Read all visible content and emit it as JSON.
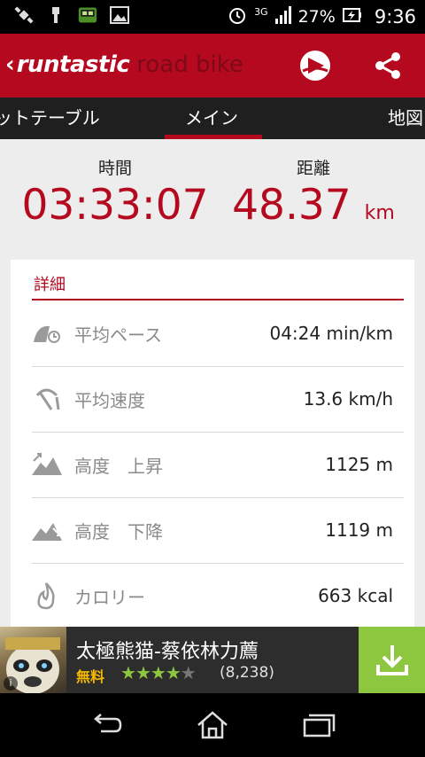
{
  "status_bar": {
    "network": "3G",
    "battery": "27%",
    "time": "9:36"
  },
  "app_bar": {
    "brand": "runtastic",
    "subtitle": "road bike"
  },
  "tabs": [
    {
      "label": "ットテーブル"
    },
    {
      "label": "メイン",
      "selected": true
    },
    {
      "label": "地図"
    }
  ],
  "summary": {
    "time_label": "時間",
    "time_value": "03:33:07",
    "distance_label": "距離",
    "distance_value": "48.37",
    "distance_unit": "km"
  },
  "details": {
    "title": "詳細",
    "rows": [
      {
        "icon": "pace-icon",
        "label": "平均ペース",
        "value": "04:24 min/km"
      },
      {
        "icon": "speedometer-icon",
        "label": "平均速度",
        "value": "13.6  km/h"
      },
      {
        "icon": "elevation-gain-icon",
        "label": "高度　上昇",
        "value": "1125 m"
      },
      {
        "icon": "elevation-loss-icon",
        "label": "高度　下降",
        "value": "1119 m"
      },
      {
        "icon": "flame-icon",
        "label": "カロリー",
        "value": "663 kcal"
      }
    ]
  },
  "ad": {
    "title": "太極熊猫-蔡依林力薦",
    "price": "無料",
    "rating_stars": 4,
    "rating_count": "(8,238)",
    "info_icon": "i"
  },
  "colors": {
    "accent": "#b4091f",
    "ad_green": "#8dc63f"
  }
}
